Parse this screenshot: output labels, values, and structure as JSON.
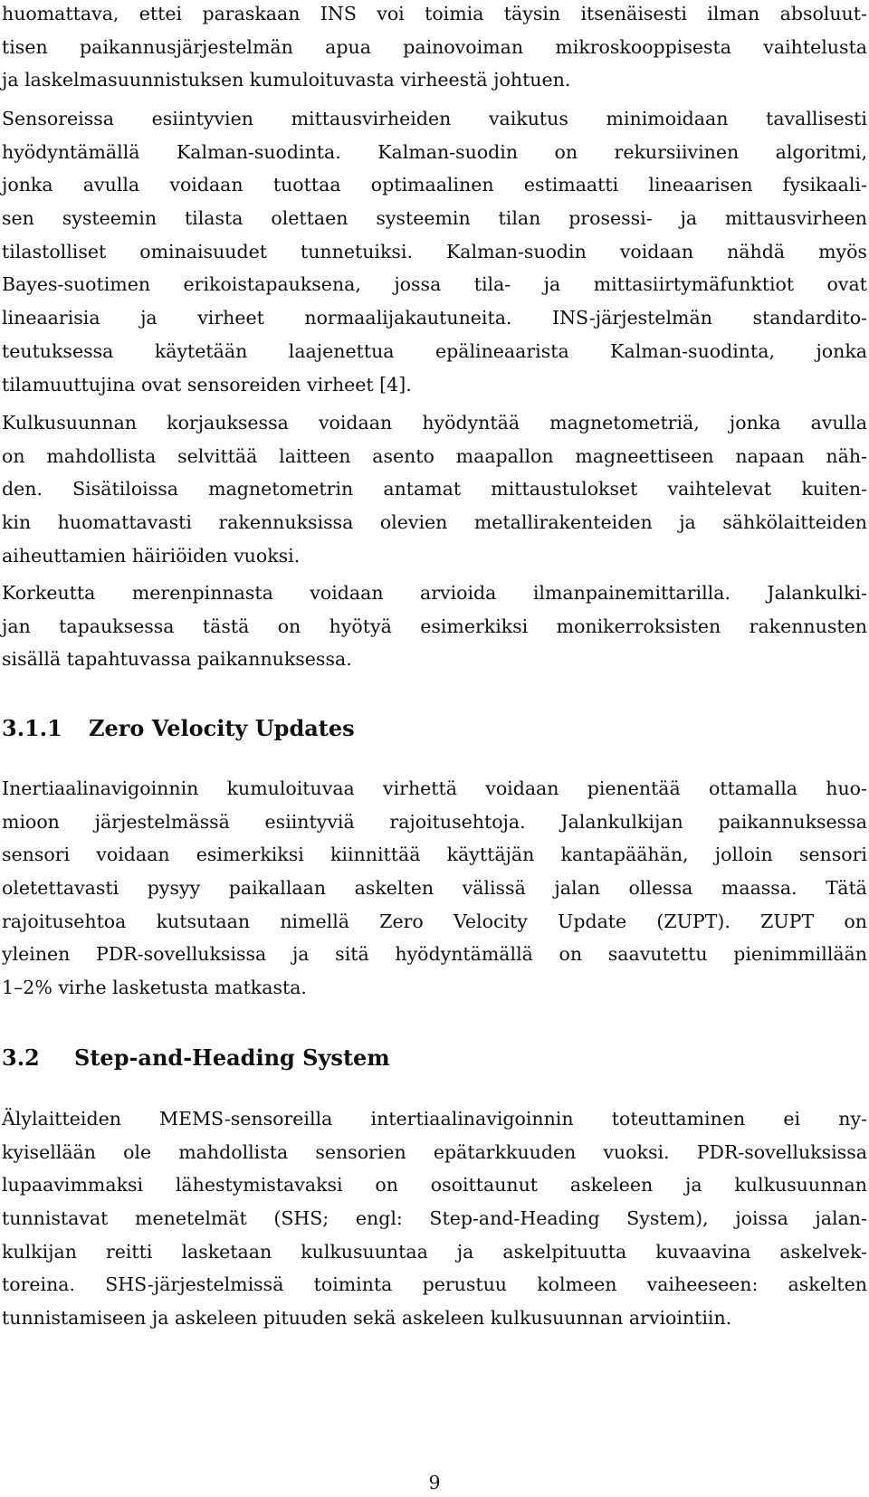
{
  "document": {
    "page_number": "9",
    "blocks": [
      {
        "type": "paragraph",
        "lines": [
          "huomattava, ettei paraskaan INS voi toimia täysin itsenäisesti ilman absoluut-",
          "tisen paikannusjärjestelmän apua painovoiman mikroskooppisesta vaihtelusta",
          "ja laskelmasuunnistuksen kumuloituvasta virheestä johtuen."
        ]
      },
      {
        "type": "paragraph",
        "lines": [
          "Sensoreissa esiintyvien mittausvirheiden vaikutus minimoidaan tavallisesti",
          "hyödyntämällä Kalman-suodinta. Kalman-suodin on rekursiivinen algoritmi,",
          "jonka avulla voidaan tuottaa optimaalinen estimaatti lineaarisen fysikaali-",
          "sen systeemin tilasta olettaen systeemin tilan prosessi- ja mittausvirheen",
          "tilastolliset ominaisuudet tunnetuiksi. Kalman-suodin voidaan nähdä myös",
          "Bayes-suotimen erikoistapauksena, jossa tila- ja mittasiirtymäfunktiot ovat",
          "lineaarisia ja virheet normaalijakautuneita. INS-järjestelmän standardito-",
          "teutuksessa käytetään laajenettua epälineaarista Kalman-suodinta, jonka",
          "tilamuuttujina ovat sensoreiden virheet [4]."
        ]
      },
      {
        "type": "paragraph",
        "lines": [
          "Kulkusuunnan korjauksessa voidaan hyödyntää magnetometriä, jonka avulla",
          "on mahdollista selvittää laitteen asento maapallon magneettiseen napaan näh-",
          "den. Sisätiloissa magnetometrin antamat mittaustulokset vaihtelevat kuiten-",
          "kin huomattavasti rakennuksissa olevien metallirakenteiden ja sähkölaitteiden",
          "aiheuttamien häiriöiden vuoksi."
        ]
      },
      {
        "type": "paragraph",
        "lines": [
          "Korkeutta merenpinnasta voidaan arvioida ilmanpainemittarilla. Jalankulki-",
          "jan tapauksessa tästä on hyötyä esimerkiksi monikerroksisten rakennusten",
          "sisällä tapahtuvassa paikannuksessa."
        ]
      },
      {
        "type": "subsection_heading",
        "number": "3.1.1",
        "title": "Zero Velocity Updates"
      },
      {
        "type": "paragraph",
        "lines": [
          "Inertiaalinavigoinnin kumuloituvaa virhettä voidaan pienentää ottamalla huo-",
          "mioon järjestelmässä esiintyviä rajoitusehtoja. Jalankulkijan paikannuksessa",
          "sensori voidaan esimerkiksi kiinnittää käyttäjän kantapäähän, jolloin sensori",
          "oletettavasti pysyy paikallaan askelten välissä jalan ollessa maassa. Tätä",
          "rajoitusehtoa kutsutaan nimellä Zero Velocity Update (ZUPT). ZUPT on",
          "yleinen PDR-sovelluksissa ja sitä hyödyntämällä on saavutettu pienimmillään",
          "1–2% virhe lasketusta matkasta."
        ]
      },
      {
        "type": "section_heading",
        "number": "3.2",
        "title": "Step-and-Heading System"
      },
      {
        "type": "paragraph",
        "lines": [
          "Älylaitteiden MEMS-sensoreilla intertiaalinavigoinnin toteuttaminen ei ny-",
          "kyisellään ole mahdollista sensorien epätarkkuuden vuoksi. PDR-sovelluksissa",
          "lupaavimmaksi lähestymistavaksi on osoittaunut askeleen ja kulkusuunnan",
          "tunnistavat menetelmät (SHS; engl: Step-and-Heading System), joissa jalan-",
          "kulkijan reitti lasketaan kulkusuuntaa ja askelpituutta kuvaavina askelvek-",
          "toreina. SHS-järjestelmissä toiminta perustuu kolmeen vaiheeseen: askelten",
          "tunnistamiseen ja askeleen pituuden sekä askeleen kulkusuunnan arviointiin."
        ]
      }
    ]
  }
}
